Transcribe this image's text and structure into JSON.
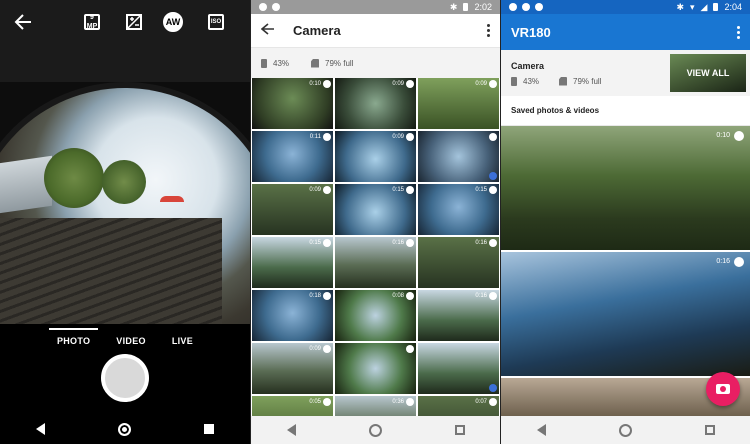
{
  "camera": {
    "icons": [
      "back-arrow-icon",
      "megapixel-icon",
      "exposure-icon",
      "white-balance-icon",
      "iso-icon"
    ],
    "mp_label": "9 MP",
    "wb_label": "AW",
    "iso_label": "ISO",
    "modes": [
      "PHOTO",
      "VIDEO",
      "LIVE"
    ],
    "active_mode": "PHOTO"
  },
  "gallery": {
    "status_time": "2:02",
    "title": "Camera",
    "battery": "43%",
    "storage": "79% full",
    "thumbs": [
      {
        "dur": "0:10"
      },
      {
        "dur": "0:09"
      },
      {
        "dur": "0:09"
      },
      {
        "dur": "0:11"
      },
      {
        "dur": "0:09"
      },
      {
        "dur": ""
      },
      {
        "dur": "0:09"
      },
      {
        "dur": "0:15"
      },
      {
        "dur": "0:15"
      },
      {
        "dur": "0:15"
      },
      {
        "dur": "0:16"
      },
      {
        "dur": "0:16"
      },
      {
        "dur": "0:18"
      },
      {
        "dur": "0:08"
      },
      {
        "dur": "0:16"
      },
      {
        "dur": "0:09"
      },
      {
        "dur": ""
      },
      {
        "dur": ""
      },
      {
        "dur": "0:05"
      },
      {
        "dur": "0:36"
      },
      {
        "dur": "0:07"
      }
    ]
  },
  "vr180": {
    "status_time": "2:04",
    "title": "VR180",
    "camera_title": "Camera",
    "battery": "43%",
    "storage": "79% full",
    "view_all": "VIEW ALL",
    "section": "Saved photos & videos",
    "videos": [
      {
        "dur": "0:10"
      },
      {
        "dur": "0:16"
      }
    ]
  },
  "colors": {
    "appbar": "#1976d2",
    "fab": "#e91e63",
    "check": "#3b6fd8"
  }
}
